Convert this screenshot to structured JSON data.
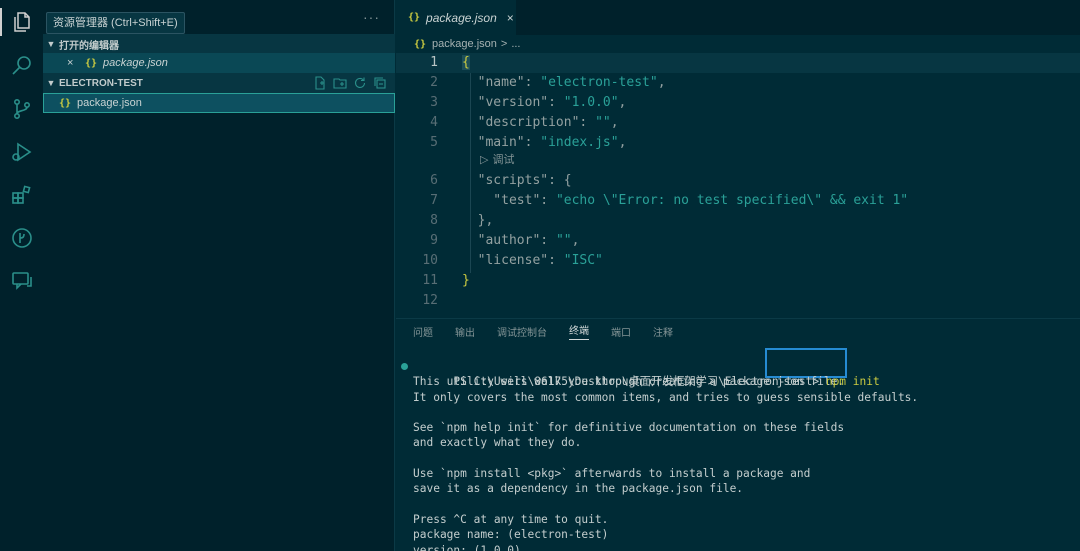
{
  "tooltip": "资源管理器 (Ctrl+Shift+E)",
  "sidebar": {
    "more": "···",
    "open_editors_title": "打开的编辑器",
    "open_file": {
      "close": "×",
      "icon": "{}",
      "name": "package.json"
    },
    "project_title": "ELECTRON-TEST",
    "tree_file": {
      "icon": "{}",
      "name": "package.json"
    }
  },
  "editor": {
    "tab": {
      "icon": "{}",
      "name": "package.json",
      "close": "×"
    },
    "breadcrumb": {
      "icon": "{}",
      "file": "package.json",
      "sep": ">",
      "more": "..."
    },
    "codelens": "调试",
    "codelens_icon": "▷",
    "lines": [
      {
        "n": "1",
        "parts": [
          [
            "br",
            "{"
          ]
        ]
      },
      {
        "n": "2",
        "parts": [
          [
            "k",
            "  \"name\""
          ],
          [
            "p",
            ": "
          ],
          [
            "s",
            "\"electron-test\""
          ],
          [
            "p",
            ","
          ]
        ]
      },
      {
        "n": "3",
        "parts": [
          [
            "k",
            "  \"version\""
          ],
          [
            "p",
            ": "
          ],
          [
            "s",
            "\"1.0.0\""
          ],
          [
            "p",
            ","
          ]
        ]
      },
      {
        "n": "4",
        "parts": [
          [
            "k",
            "  \"description\""
          ],
          [
            "p",
            ": "
          ],
          [
            "s",
            "\"\""
          ],
          [
            "p",
            ","
          ]
        ]
      },
      {
        "n": "5",
        "parts": [
          [
            "k",
            "  \"main\""
          ],
          [
            "p",
            ": "
          ],
          [
            "s",
            "\"index.js\""
          ],
          [
            "p",
            ","
          ]
        ]
      },
      {
        "n": "6",
        "parts": [
          [
            "k",
            "  \"scripts\""
          ],
          [
            "p",
            ": {"
          ]
        ]
      },
      {
        "n": "7",
        "parts": [
          [
            "k",
            "    \"test\""
          ],
          [
            "p",
            ": "
          ],
          [
            "s",
            "\"echo \\\"Error: no test specified\\\" && exit 1\""
          ]
        ]
      },
      {
        "n": "8",
        "parts": [
          [
            "p",
            "  },"
          ]
        ]
      },
      {
        "n": "9",
        "parts": [
          [
            "k",
            "  \"author\""
          ],
          [
            "p",
            ": "
          ],
          [
            "s",
            "\"\""
          ],
          [
            "p",
            ","
          ]
        ]
      },
      {
        "n": "10",
        "parts": [
          [
            "k",
            "  \"license\""
          ],
          [
            "p",
            ": "
          ],
          [
            "s",
            "\"ISC\""
          ]
        ]
      },
      {
        "n": "11",
        "parts": [
          [
            "br",
            "}"
          ]
        ]
      },
      {
        "n": "12",
        "parts": []
      }
    ]
  },
  "panel": {
    "tabs": [
      "问题",
      "输出",
      "调试控制台",
      "终端",
      "端口",
      "注释"
    ],
    "active_tab": "终端",
    "prompt": "PS C:\\Users\\86175\\Desktop\\桌面开发框架学习\\Electron-test>",
    "command": "npm init",
    "output": [
      "This utility will walk you through creating a package.json file.",
      "It only covers the most common items, and tries to guess sensible defaults.",
      "",
      "See `npm help init` for definitive documentation on these fields",
      "and exactly what they do.",
      "",
      "Use `npm install <pkg>` afterwards to install a package and",
      "save it as a dependency in the package.json file.",
      "",
      "Press ^C at any time to quit.",
      "package name: (electron-test)",
      "version: (1.0.0)"
    ]
  },
  "colors": {
    "accent": "#268bd2",
    "json_icon": "#cbcb41",
    "string": "#2aa198",
    "background": "#002b36"
  }
}
